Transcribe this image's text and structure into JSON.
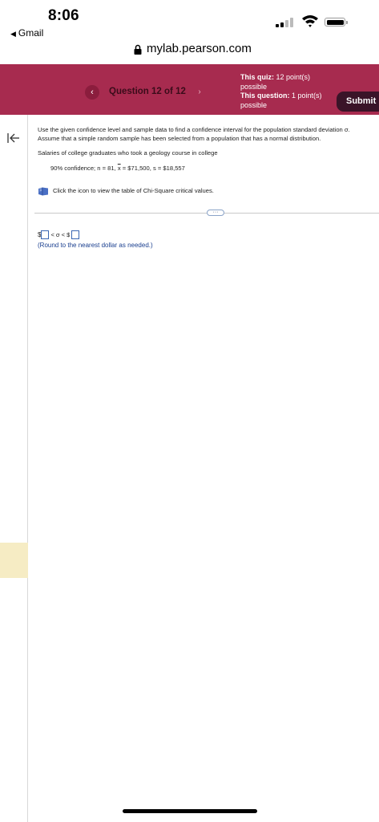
{
  "status_bar": {
    "time": "8:06",
    "back_app": "Gmail"
  },
  "browser": {
    "url": "mylab.pearson.com"
  },
  "header": {
    "question_label": "Question 12 of 12",
    "quiz_label": "This quiz:",
    "quiz_value": "12 point(s) possible",
    "question_points_label": "This question:",
    "question_points_value": "1 point(s) possible",
    "submit_label": "Submit",
    "color": "#a72b4f"
  },
  "question": {
    "instruction_1": "Use the given confidence level and sample data to find a confidence interval for the population standard deviation σ.",
    "instruction_2": "Assume that a simple random sample has been selected from a population that has a normal distribution.",
    "context": "Salaries of college graduates who took a geology course in college",
    "data_prefix": "90% confidence; n = 81,",
    "data_xbar": "x",
    "data_suffix": "= $71,500, s = $18,557",
    "icon_text": "Click the icon to view the table of Chi-Square critical values."
  },
  "answer": {
    "currency_left": "$",
    "middle": "< σ < $",
    "hint": "(Round to the nearest dollar as needed.)"
  }
}
